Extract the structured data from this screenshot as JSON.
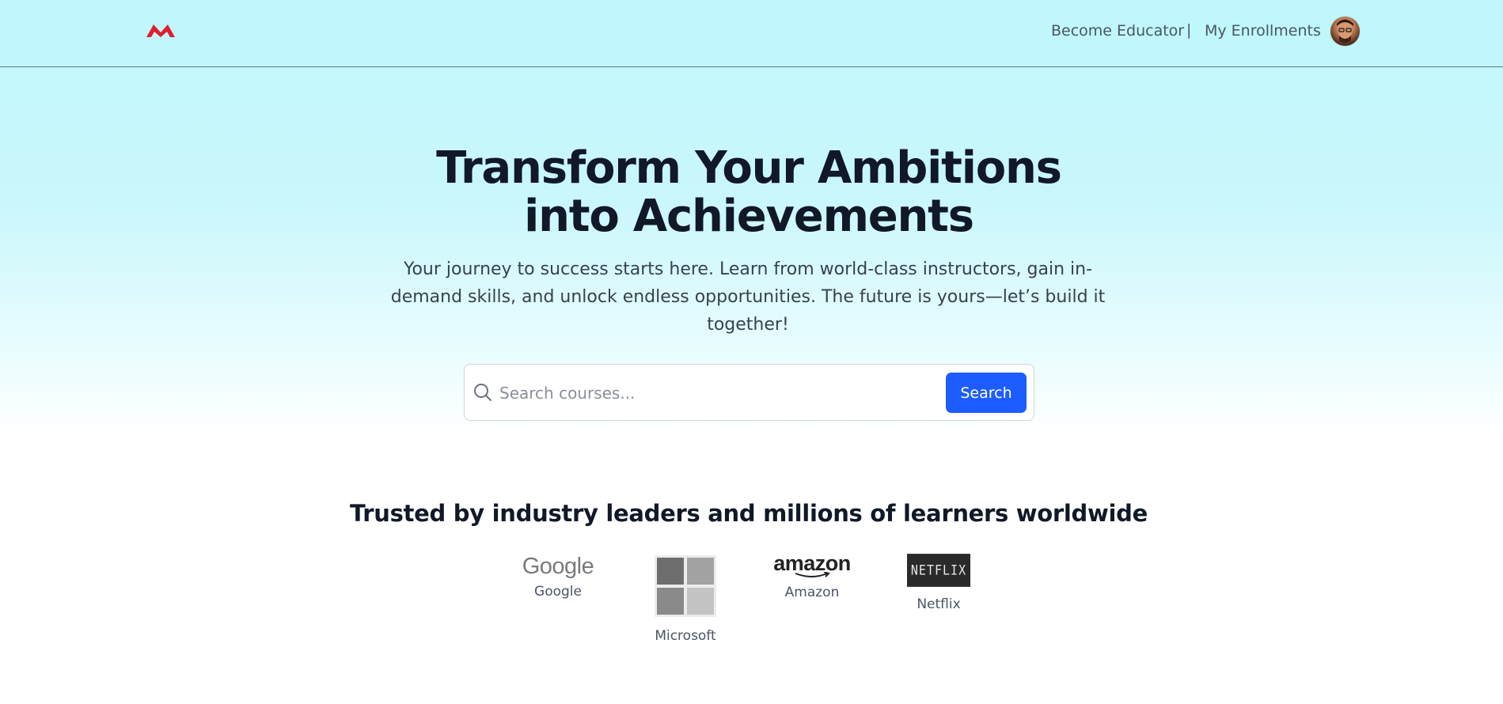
{
  "header": {
    "logo_icon": "brand-m-logo",
    "nav": {
      "become_educator": "Become Educator",
      "separator": "|",
      "my_enrollments": "My Enrollments"
    },
    "avatar_icon": "user-avatar"
  },
  "hero": {
    "title_line1": "Transform Your Ambitions",
    "title_line2": "into Achievements",
    "subtitle": "Your journey to success starts here. Learn from world-class instructors, gain in-demand skills, and unlock endless opportunities. The future is yours—let’s build it together!"
  },
  "search": {
    "placeholder": "Search courses...",
    "value": "",
    "button_label": "Search",
    "icon": "search-icon"
  },
  "trusted": {
    "title": "Trusted by industry leaders and millions of learners worldwide",
    "brands": [
      {
        "logo_text": "Google",
        "label": "Google"
      },
      {
        "logo_text": "",
        "label": "Microsoft"
      },
      {
        "logo_text": "amazon",
        "label": "Amazon"
      },
      {
        "logo_text": "NETFLIX",
        "label": "Netflix"
      }
    ]
  },
  "colors": {
    "header_bg": "#bff7fc",
    "primary_button": "#1d5cff",
    "logo_red": "#e11d2e",
    "heading": "#111827"
  }
}
